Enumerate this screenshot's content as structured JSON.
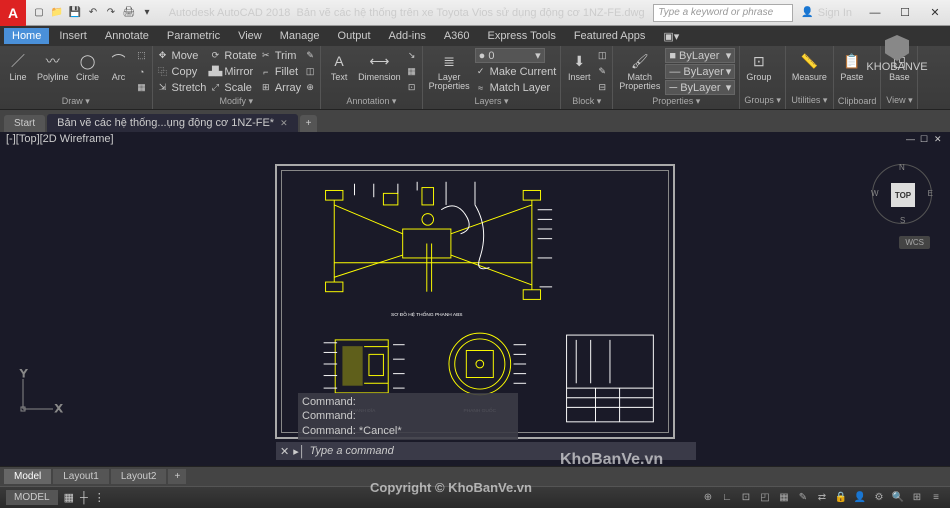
{
  "app": {
    "name": "Autodesk AutoCAD 2018",
    "doc": "Bản vẽ các hệ thống trên xe Toyota Vios sử dụng động cơ 1NZ-FE.dwg",
    "search_placeholder": "Type a keyword or phrase",
    "signin": "Sign In"
  },
  "menu": [
    "Home",
    "Insert",
    "Annotate",
    "Parametric",
    "View",
    "Manage",
    "Output",
    "Add-ins",
    "A360",
    "Express Tools",
    "Featured Apps"
  ],
  "ribbon": {
    "draw": {
      "title": "Draw ▾",
      "line": "Line",
      "polyline": "Polyline",
      "circle": "Circle",
      "arc": "Arc"
    },
    "modify": {
      "title": "Modify ▾",
      "move": "Move",
      "copy": "Copy",
      "stretch": "Stretch",
      "rotate": "Rotate",
      "mirror": "Mirror",
      "scale": "Scale",
      "trim": "Trim",
      "fillet": "Fillet",
      "array": "Array"
    },
    "annot": {
      "title": "Annotation ▾",
      "text": "Text",
      "dim": "Dimension"
    },
    "layers": {
      "title": "Layers ▾",
      "props": "Layer\nProperties",
      "make": "Make Current",
      "match": "Match Layer"
    },
    "block": {
      "title": "Block ▾",
      "insert": "Insert"
    },
    "props": {
      "title": "Properties ▾",
      "match": "Match\nProperties",
      "bylayer": "ByLayer"
    },
    "groups": {
      "title": "Groups ▾",
      "group": "Group"
    },
    "utils": {
      "title": "Utilities ▾",
      "measure": "Measure"
    },
    "clip": {
      "title": "Clipboard",
      "paste": "Paste"
    },
    "view": {
      "title": "View ▾",
      "base": "Base"
    }
  },
  "tabs": {
    "start": "Start",
    "file": "Bản vẽ các hệ thống...ụng động cơ 1NZ-FE*"
  },
  "viewport": {
    "label": "[-][Top][2D Wireframe]"
  },
  "navcube": {
    "top": "TOP",
    "wcs": "WCS"
  },
  "drawing": {
    "title1": "SƠ ĐỒ HỆ THỐNG PHANH ABS",
    "title2": "PHANH ĐĨA",
    "title3": "PHANH GUỐC"
  },
  "cmd": {
    "h1": "Command:",
    "h2": "Command:",
    "h3": "Command: *Cancel*",
    "prompt": "▸│",
    "placeholder": "Type a command"
  },
  "layout": {
    "model": "Model",
    "l1": "Layout1",
    "l2": "Layout2"
  },
  "status": {
    "model": "MODEL"
  },
  "watermark": {
    "brand": "KhoBanVe.vn",
    "copy": "Copyright © KhoBanVe.vn",
    "logo": "KHOBANVE"
  }
}
